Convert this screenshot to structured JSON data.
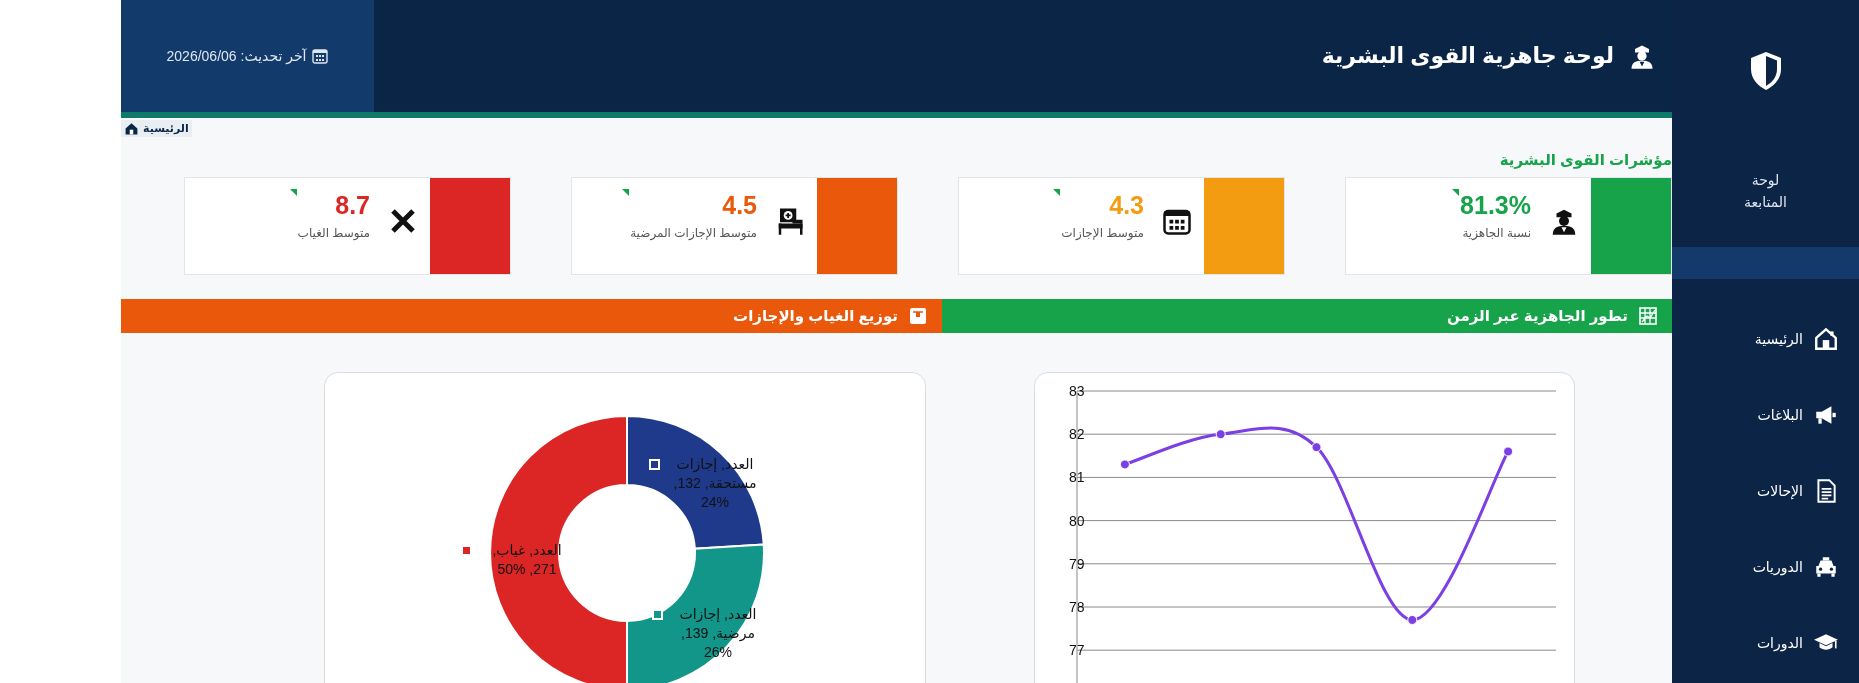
{
  "sidebar": {
    "title": "لوحة المتابعة",
    "items": [
      {
        "label": "الرئيسية"
      },
      {
        "label": "البلاغات"
      },
      {
        "label": "الإحالات"
      },
      {
        "label": "الدوريات"
      },
      {
        "label": "الدورات"
      }
    ]
  },
  "header": {
    "title": "لوحة جاهزية القوى البشرية",
    "last_update": "آخر تحديث: 2026/06/06"
  },
  "breadcrumb": {
    "label": "الرئيسية"
  },
  "kpis": {
    "title": "مؤشرات القوى البشرية",
    "cards": [
      {
        "value": "81.3%",
        "label": "نسبة الجاهزية",
        "color": "#16a34a"
      },
      {
        "value": "4.3",
        "label": "متوسط الإجازات",
        "color": "#f39c12"
      },
      {
        "value": "4.5",
        "label": "متوسط الإجازات المرضية",
        "color": "#ea580c"
      },
      {
        "value": "8.7",
        "label": "متوسط الغياب",
        "color": "#dc2626"
      }
    ]
  },
  "sections": [
    {
      "title": "تطور الجاهزية عبر الزمن",
      "color": "#16a34a",
      "chart_data": {
        "type": "line",
        "ylim": [
          76,
          83
        ],
        "yticks": [
          77,
          78,
          79,
          80,
          81,
          82,
          83
        ],
        "grid": true,
        "series": [
          {
            "color": "#7b3fe4",
            "marker": "circle",
            "values": [
              81.3,
              82.0,
              81.7,
              77.7,
              81.6
            ]
          }
        ]
      }
    },
    {
      "title": "توزيع الغياب والإجازات",
      "color": "#ea580c",
      "chart_data": {
        "type": "donut",
        "series": [
          {
            "colors": [
              "#1f3a8a",
              "#12968a",
              "#dc2626"
            ],
            "values": [
              24,
              26,
              50
            ]
          }
        ],
        "value_labels": [
          "العدد, إجازات مستحقة, 132, %24",
          "العدد, إجازات مرضية, 139, %26",
          "العدد, غياب, 271, %50"
        ]
      }
    }
  ]
}
